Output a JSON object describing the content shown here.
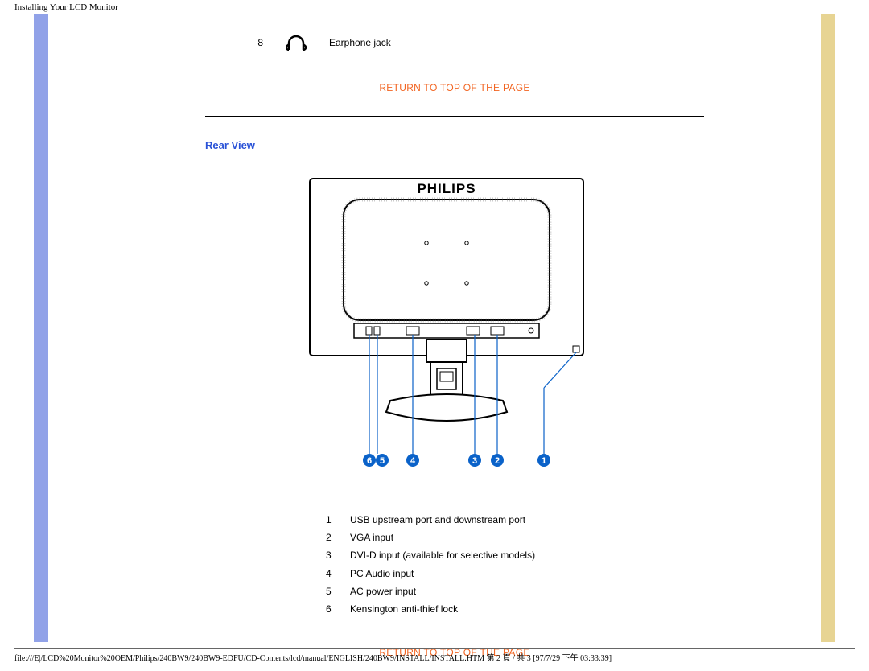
{
  "header": "Installing Your LCD Monitor",
  "top_item": {
    "num": "8",
    "label": "Earphone jack"
  },
  "return_link": "RETURN TO TOP OF THE PAGE",
  "section_title": "Rear View",
  "brand": "PHILIPS",
  "callouts": [
    "6",
    "5",
    "4",
    "3",
    "2",
    "1"
  ],
  "ports": [
    {
      "n": "1",
      "label": "USB upstream port and downstream port"
    },
    {
      "n": "2",
      "label": "VGA input"
    },
    {
      "n": "3",
      "label": "DVI-D input (available for selective models)"
    },
    {
      "n": "4",
      "label": "PC Audio input"
    },
    {
      "n": "5",
      "label": "AC power input"
    },
    {
      "n": "6",
      "label": "Kensington anti-thief lock"
    }
  ],
  "footer": "file:///E|/LCD%20Monitor%20OEM/Philips/240BW9/240BW9-EDFU/CD-Contents/lcd/manual/ENGLISH/240BW9/INSTALL/INSTALL.HTM 第 2 頁 / 共 3  [97/7/29 下午 03:33:39]"
}
